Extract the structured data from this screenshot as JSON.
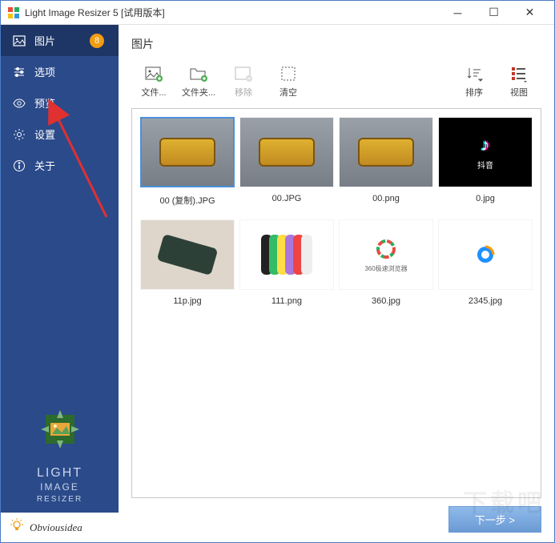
{
  "window": {
    "title": "Light Image Resizer 5  [试用版本]"
  },
  "sidebar": {
    "items": [
      {
        "label": "图片",
        "badge": "8"
      },
      {
        "label": "选项"
      },
      {
        "label": "预览"
      },
      {
        "label": "设置"
      },
      {
        "label": "关于"
      }
    ],
    "logo": {
      "line1": "LIGHT",
      "line2": "IMAGE",
      "line3": "RESIZER"
    },
    "brand": "Obviousidea"
  },
  "main": {
    "heading": "图片",
    "toolbar": {
      "file": "文件...",
      "folder": "文件夹...",
      "remove": "移除",
      "clear": "清空",
      "sort": "排序",
      "view": "视图"
    },
    "thumbs": [
      {
        "name": "00 (复制).JPG"
      },
      {
        "name": "00.JPG"
      },
      {
        "name": "00.png"
      },
      {
        "name": "0.jpg"
      },
      {
        "name": "11p.jpg"
      },
      {
        "name": "111.png"
      },
      {
        "name": "360.jpg"
      },
      {
        "name": "2345.jpg"
      }
    ],
    "next": "下一步 >",
    "tiktok_text": "抖音",
    "logo360": "360极速浏览器"
  }
}
